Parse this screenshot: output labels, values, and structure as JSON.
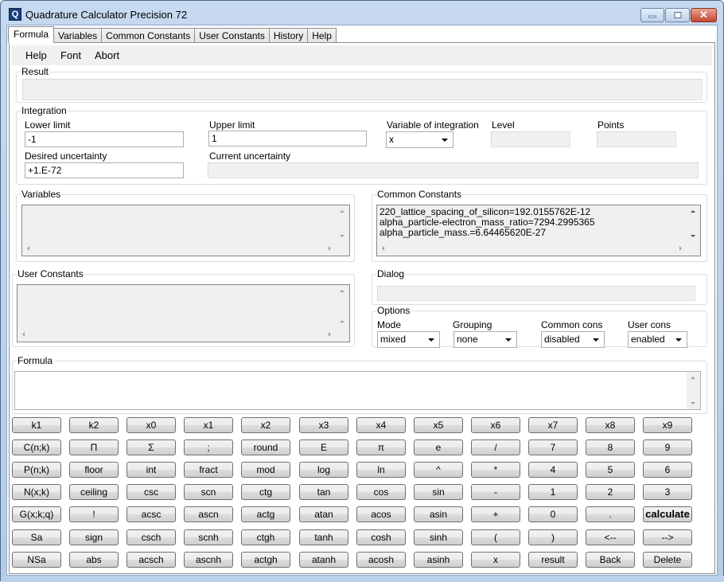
{
  "window": {
    "title": "Quadrature Calculator Precision 72",
    "icon": "app-q-icon",
    "controls": [
      "minimize-icon",
      "maximize-icon",
      "close-icon"
    ]
  },
  "tabs": [
    {
      "label": "Formula",
      "active": true
    },
    {
      "label": "Variables",
      "active": false
    },
    {
      "label": "Common Constants",
      "active": false
    },
    {
      "label": "User Constants",
      "active": false
    },
    {
      "label": "History",
      "active": false
    },
    {
      "label": "Help",
      "active": false
    }
  ],
  "menu": [
    "Help",
    "Font",
    "Abort"
  ],
  "result": {
    "label": "Result",
    "value": ""
  },
  "integration": {
    "label": "Integration",
    "lower_limit": {
      "label": "Lower limit",
      "value": "-1"
    },
    "upper_limit": {
      "label": "Upper limit",
      "value": "1"
    },
    "variable": {
      "label": "Variable of integration",
      "value": "x"
    },
    "level": {
      "label": "Level",
      "value": ""
    },
    "points": {
      "label": "Points",
      "value": ""
    },
    "desired_uncertainty": {
      "label": "Desired uncertainty",
      "value": "+1.E-72"
    },
    "current_uncertainty": {
      "label": "Current uncertainty",
      "value": ""
    }
  },
  "variables": {
    "label": "Variables",
    "items": []
  },
  "common_constants": {
    "label": "Common Constants",
    "items": [
      "220_lattice_spacing_of_silicon=192.0155762E-12",
      "alpha_particle-electron_mass_ratio=7294.2995365",
      "alpha_particle_mass.=6.64465620E-27"
    ]
  },
  "user_constants": {
    "label": "User Constants",
    "items": []
  },
  "dialog": {
    "label": "Dialog",
    "value": ""
  },
  "options": {
    "label": "Options",
    "mode": {
      "label": "Mode",
      "value": "mixed"
    },
    "grouping": {
      "label": "Grouping",
      "value": "none"
    },
    "common_cons": {
      "label": "Common cons",
      "value": "disabled"
    },
    "user_cons": {
      "label": "User cons",
      "value": "enabled"
    }
  },
  "formula": {
    "label": "Formula",
    "value": ""
  },
  "keypad": [
    [
      "k1",
      "k2",
      "x0",
      "x1",
      "x2",
      "x3",
      "x4",
      "x5",
      "x6",
      "x7",
      "x8",
      "x9"
    ],
    [
      "C(n;k)",
      "Π",
      "Σ",
      ";",
      "round",
      "E",
      "π",
      "e",
      "/",
      "7",
      "8",
      "9"
    ],
    [
      "P(n;k)",
      "floor",
      "int",
      "fract",
      "mod",
      "log",
      "ln",
      "^",
      "*",
      "4",
      "5",
      "6"
    ],
    [
      "N(x;k)",
      "ceiling",
      "csc",
      "scn",
      "ctg",
      "tan",
      "cos",
      "sin",
      "-",
      "1",
      "2",
      "3"
    ],
    [
      "G(x;k;q)",
      "!",
      "acsc",
      "ascn",
      "actg",
      "atan",
      "acos",
      "asin",
      "+",
      "0",
      ".",
      "calculate"
    ],
    [
      "Sa",
      "sign",
      "csch",
      "scnh",
      "ctgh",
      "tanh",
      "cosh",
      "sinh",
      "(",
      ")",
      "<--",
      "-->"
    ],
    [
      "NSa",
      "abs",
      "acsch",
      "ascnh",
      "actgh",
      "atanh",
      "acosh",
      "asinh",
      "x",
      "result",
      "Back",
      "Delete"
    ]
  ]
}
